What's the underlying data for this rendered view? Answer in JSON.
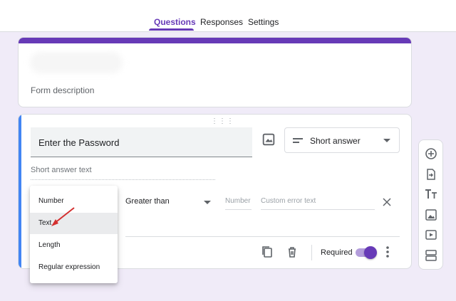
{
  "tabs": {
    "questions": "Questions",
    "responses": "Responses",
    "settings": "Settings"
  },
  "title_card": {
    "form_description": "Form description"
  },
  "question": {
    "title": "Enter the Password",
    "type_label": "Short answer",
    "short_answer_placeholder": "Short answer text",
    "validation_condition": "Greater than",
    "number_placeholder": "Number",
    "error_placeholder": "Custom error text",
    "required_label": "Required",
    "required": true
  },
  "validation_dropdown": {
    "options": [
      "Number",
      "Text",
      "Length",
      "Regular expression"
    ],
    "highlighted": "Text"
  },
  "colors": {
    "accent": "#673ab7",
    "active_card_border": "#4285f4",
    "arrow": "#d32f2f"
  },
  "toolbar_icons": [
    "add-question-icon",
    "import-questions-icon",
    "add-title-icon",
    "add-image-icon",
    "add-video-icon",
    "add-section-icon"
  ]
}
